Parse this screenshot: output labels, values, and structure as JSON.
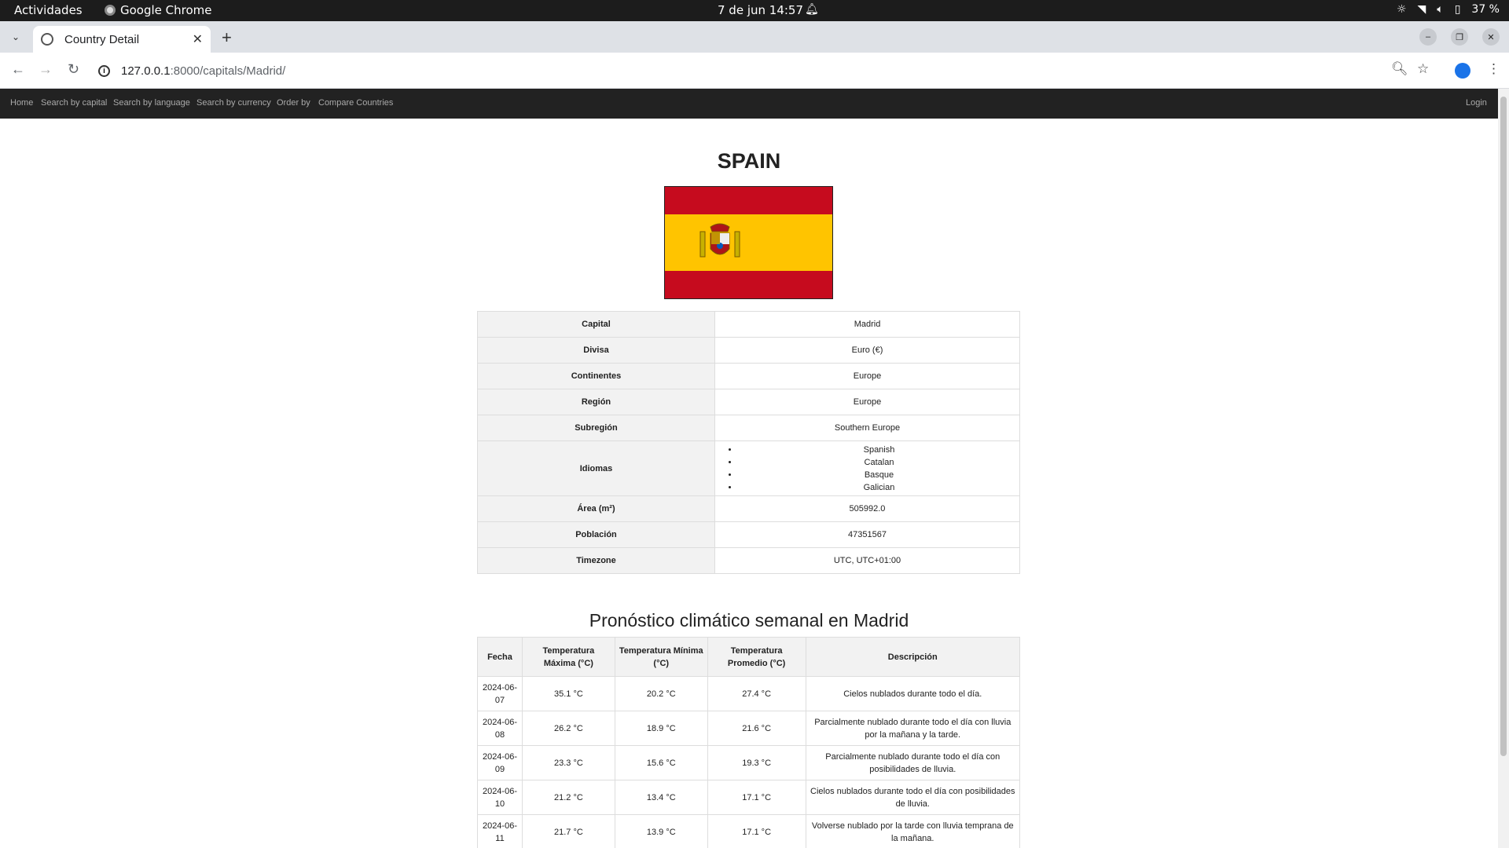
{
  "os": {
    "activities": "Actividades",
    "app_name": "Google Chrome",
    "clock": "7 de jun  14:57",
    "battery": "37 %"
  },
  "browser": {
    "tab_title": "Country Detail",
    "url_host": "127.0.0.1",
    "url_path": ":8000/capitals/Madrid/"
  },
  "nav": {
    "links": [
      "Home",
      "Search by capital",
      "Search by language",
      "Search by currency",
      "Order by",
      "Compare Countries"
    ],
    "login": "Login"
  },
  "country": {
    "name": "SPAIN",
    "flag_colors": {
      "red": "#c60b1e",
      "yellow": "#ffc400"
    },
    "rows": [
      {
        "label": "Capital",
        "value": "Madrid"
      },
      {
        "label": "Divisa",
        "value": "Euro (€)"
      },
      {
        "label": "Continentes",
        "value": "Europe"
      },
      {
        "label": "Región",
        "value": "Europe"
      },
      {
        "label": "Subregión",
        "value": "Southern Europe"
      }
    ],
    "languages_label": "Idiomas",
    "languages": [
      "Spanish",
      "Catalan",
      "Basque",
      "Galician"
    ],
    "rows2": [
      {
        "label": "Área (m²)",
        "value": "505992.0"
      },
      {
        "label": "Población",
        "value": "47351567"
      },
      {
        "label": "Timezone",
        "value": "UTC, UTC+01:00"
      }
    ]
  },
  "weather": {
    "title": "Pronóstico climático semanal en Madrid",
    "headers": [
      "Fecha",
      "Temperatura Máxima (°C)",
      "Temperatura Mínima (°C)",
      "Temperatura Promedio (°C)",
      "Descripción"
    ],
    "rows": [
      [
        "2024-06-07",
        "35.1 °C",
        "20.2 °C",
        "27.4 °C",
        "Cielos nublados durante todo el día."
      ],
      [
        "2024-06-08",
        "26.2 °C",
        "18.9 °C",
        "21.6 °C",
        "Parcialmente nublado durante todo el día con lluvia por la mañana y la tarde."
      ],
      [
        "2024-06-09",
        "23.3 °C",
        "15.6 °C",
        "19.3 °C",
        "Parcialmente nublado durante todo el día con posibilidades de lluvia."
      ],
      [
        "2024-06-10",
        "21.2 °C",
        "13.4 °C",
        "17.1 °C",
        "Cielos nublados durante todo el día con posibilidades de lluvia."
      ],
      [
        "2024-06-11",
        "21.7 °C",
        "13.9 °C",
        "17.1 °C",
        "Volverse nublado por la tarde con lluvia temprana de la mañana."
      ]
    ]
  }
}
